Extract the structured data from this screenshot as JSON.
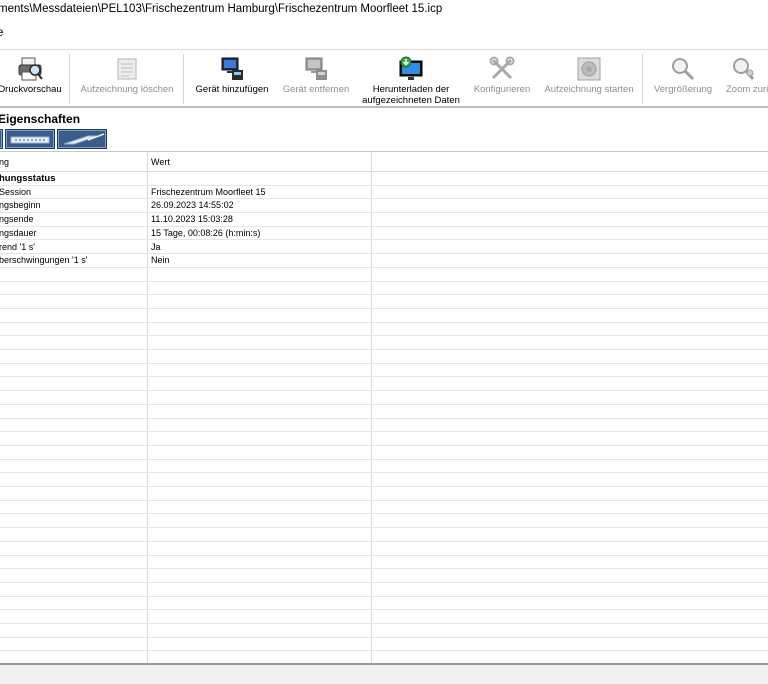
{
  "window": {
    "title": "ments\\Messdateien\\PEL103\\Frischezentrum Hamburg\\Frischezentrum Moorfleet 15.icp"
  },
  "menubar": {
    "item_label": "e"
  },
  "toolbar": {
    "buttons": [
      {
        "label": "Druckvorschau",
        "icon": "print-preview-icon",
        "enabled": true
      },
      {
        "label": "Aufzeichnung löschen",
        "icon": "delete-recording-icon",
        "enabled": false
      },
      {
        "label": "Gerät hinzufügen",
        "icon": "add-device-icon",
        "enabled": true
      },
      {
        "label": "Gerät entfernen",
        "icon": "remove-device-icon",
        "enabled": false
      },
      {
        "label": "Herunterladen der aufgezeichneten Daten",
        "line1": "Herunterladen der",
        "line2": "aufgezeichneten Daten",
        "icon": "download-data-icon",
        "enabled": true
      },
      {
        "label": "Konfigurieren",
        "icon": "configure-icon",
        "enabled": false
      },
      {
        "label": "Aufzeichnung starten",
        "icon": "start-recording-icon",
        "enabled": false
      },
      {
        "label": "Vergrößerung",
        "icon": "zoom-in-icon",
        "enabled": false
      },
      {
        "label": "Zoom zurü",
        "icon": "zoom-reset-icon",
        "enabled": false
      }
    ]
  },
  "properties": {
    "title": "Eigenschaften",
    "columns": {
      "name": "ng",
      "value": "Wert"
    },
    "group": "hungsstatus",
    "rows": [
      {
        "name": "Session",
        "value": "Frischezentrum Moorfleet 15"
      },
      {
        "name": "ngsbeginn",
        "value": "26.09.2023 14:55:02"
      },
      {
        "name": "ngsende",
        "value": "11.10.2023 15:03:28"
      },
      {
        "name": "ngsdauer",
        "value": "15 Tage, 00:08:26 (h:min:s)"
      },
      {
        "name": "rend '1 s'",
        "value": "Ja"
      },
      {
        "name": "berschwingungen '1 s'",
        "value": "Nein"
      }
    ]
  },
  "colors": {
    "tab_bg": "#3a5c8a",
    "disabled_text": "#8e8e8e",
    "grid_line": "#e6e6e6"
  }
}
